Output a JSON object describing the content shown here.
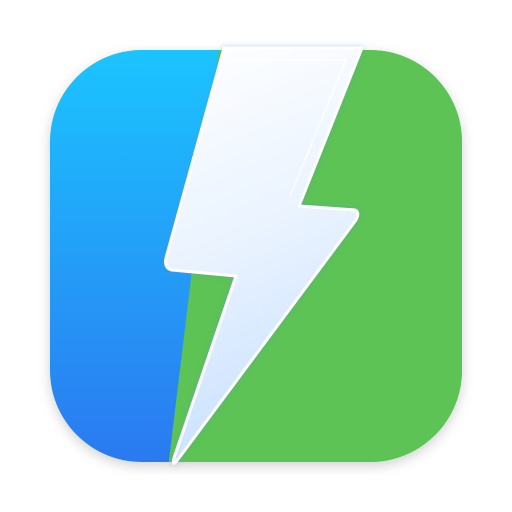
{
  "app_icon": {
    "icon": "lightning-bolt-icon",
    "colors": {
      "background": "#ffffff",
      "left_panel_top": "#1bc6ff",
      "left_panel_bottom": "#2b78f0",
      "right_panel": "#5cc354",
      "bolt_light": "#ffffff",
      "bolt_tint": "#c9e1ff"
    }
  }
}
